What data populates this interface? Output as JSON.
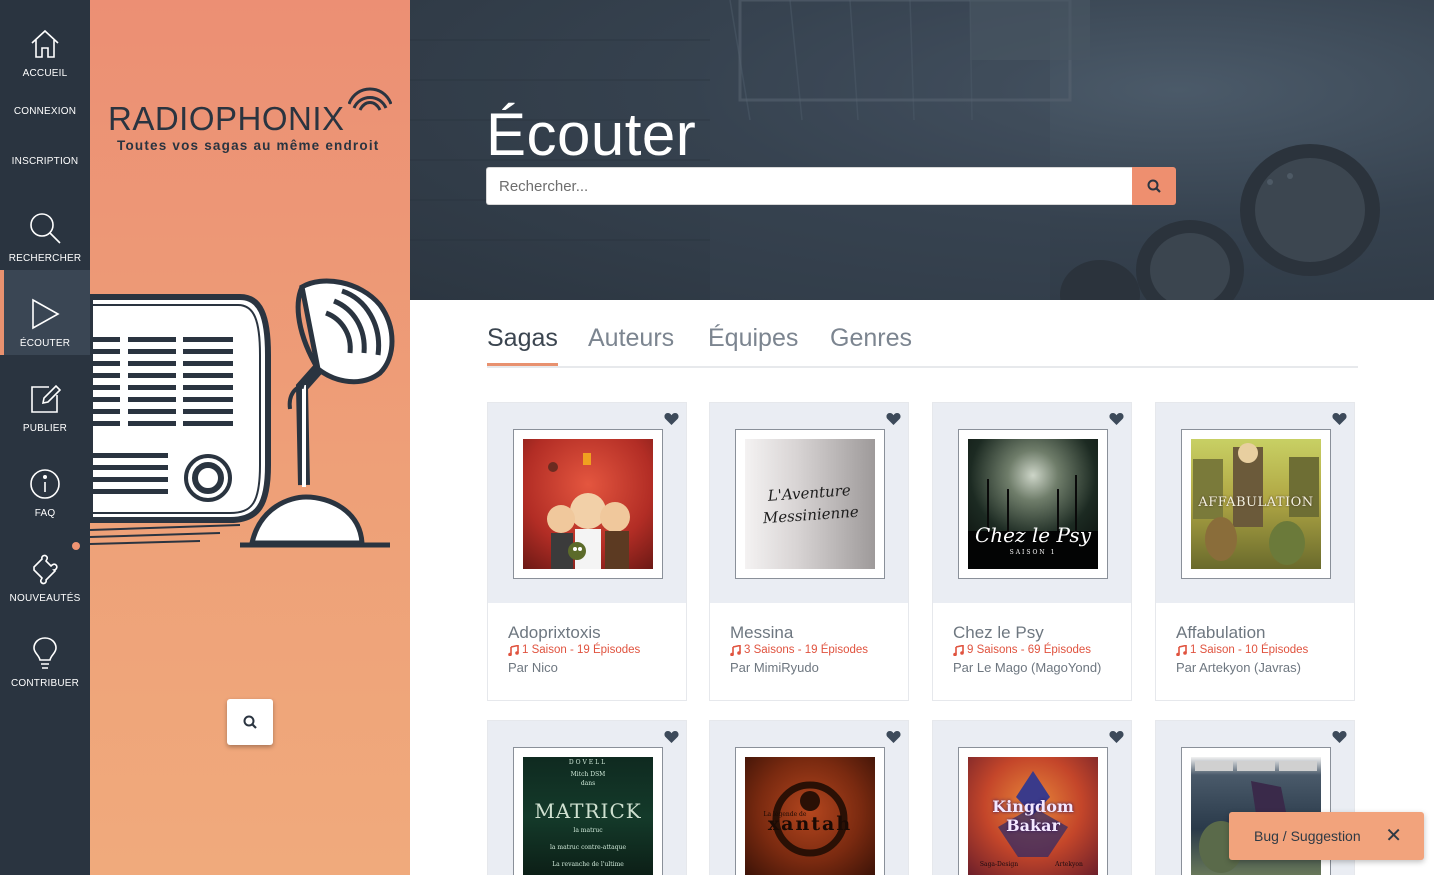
{
  "nav": {
    "items": [
      {
        "label": "ACCUEIL"
      },
      {
        "label": "CONNEXION"
      },
      {
        "label": "INSCRIPTION"
      },
      {
        "label": "RECHERCHER"
      },
      {
        "label": "ÉCOUTER"
      },
      {
        "label": "PUBLIER"
      },
      {
        "label": "FAQ"
      },
      {
        "label": "NOUVEAUTÉS"
      },
      {
        "label": "CONTRIBUER"
      }
    ]
  },
  "brand": {
    "logo": "RADIOPHONIX",
    "tagline": "Toutes vos sagas au même endroit"
  },
  "hero": {
    "title": "Écouter",
    "search_placeholder": "Rechercher..."
  },
  "tabs": [
    {
      "label": "Sagas"
    },
    {
      "label": "Auteurs"
    },
    {
      "label": "Équipes"
    },
    {
      "label": "Genres"
    }
  ],
  "sagas": [
    {
      "title": "Adoprixtoxis",
      "meta": "1 Saison - 19 Épisodes",
      "author": "Par Nico"
    },
    {
      "title": "Messina",
      "meta": "3 Saisons - 19 Épisodes",
      "author": "Par MimiRyudo"
    },
    {
      "title": "Chez le Psy",
      "meta": "9 Saisons - 69 Épisodes",
      "author": "Par Le Mago (MagoYond)"
    },
    {
      "title": "Affabulation",
      "meta": "1 Saison - 10 Épisodes",
      "author": "Par Artekyon (Javras)"
    }
  ],
  "covers": {
    "messina": "L'Aventure Messinienne",
    "psy_title": "Chez le Psy",
    "psy_sub": "SAISON 1",
    "affab": "AFFABULATION",
    "matrick_top": "DOVELL",
    "matrick_line1": "Mitch DSM",
    "matrick_line2": "dans",
    "matrick": "MATRICK",
    "matrick_sub1": "la matruc",
    "matrick_sub2": "la matruc contre-attaque",
    "matrick_sub3": "La revanche de l'ultime",
    "xantah": "xantah",
    "xantah_pre": "La légende de",
    "kingdom": "Kingdom Bakar",
    "kingdom_left": "Saga-Design",
    "kingdom_right": "Artekyon"
  },
  "bug": {
    "label": "Bug / Suggestion",
    "close": "✕"
  },
  "colors": {
    "nav_bg": "#2a3440",
    "accent": "#ee8f6f",
    "meta_red": "#e0533f"
  }
}
